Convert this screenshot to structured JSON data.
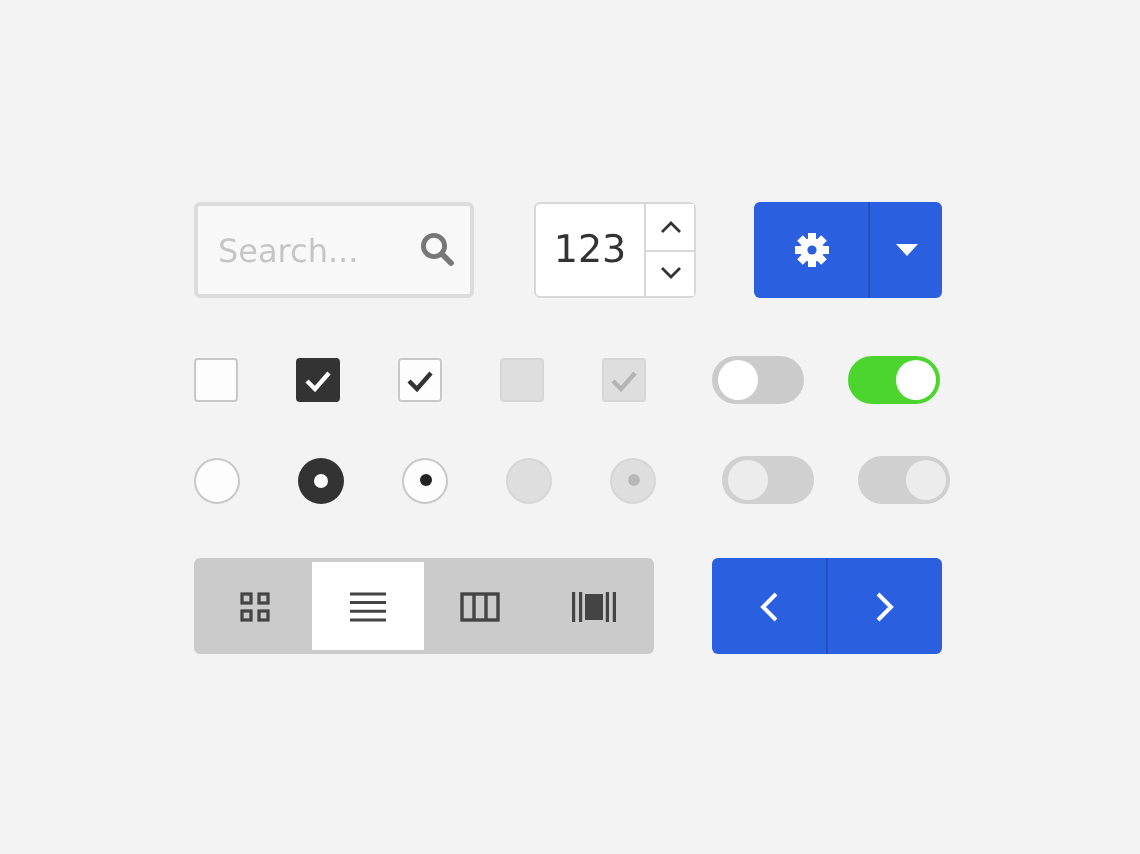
{
  "search": {
    "placeholder": "Search..."
  },
  "number": {
    "value": "123"
  },
  "checkboxes": [
    {
      "kind": "outline",
      "checked": false,
      "disabled": false
    },
    {
      "kind": "filled",
      "checked": true,
      "disabled": false
    },
    {
      "kind": "outline",
      "checked": true,
      "disabled": false
    },
    {
      "kind": "outline",
      "checked": false,
      "disabled": true
    },
    {
      "kind": "outline",
      "checked": true,
      "disabled": true
    }
  ],
  "checkbox_toggles": [
    {
      "on": false,
      "disabled": false
    },
    {
      "on": true,
      "disabled": false
    }
  ],
  "radios": [
    {
      "kind": "outline",
      "selected": false,
      "disabled": false
    },
    {
      "kind": "filled",
      "selected": true,
      "disabled": false
    },
    {
      "kind": "outline",
      "selected": true,
      "disabled": false
    },
    {
      "kind": "outline",
      "selected": false,
      "disabled": true
    },
    {
      "kind": "outline",
      "selected": true,
      "disabled": true
    }
  ],
  "radio_toggles": [
    {
      "on": false,
      "disabled": true
    },
    {
      "on": true,
      "disabled": true
    }
  ],
  "view_switcher": [
    {
      "kind": "grid",
      "selected": false
    },
    {
      "kind": "list",
      "selected": true
    },
    {
      "kind": "columns",
      "selected": false
    },
    {
      "kind": "carousel",
      "selected": false
    }
  ]
}
